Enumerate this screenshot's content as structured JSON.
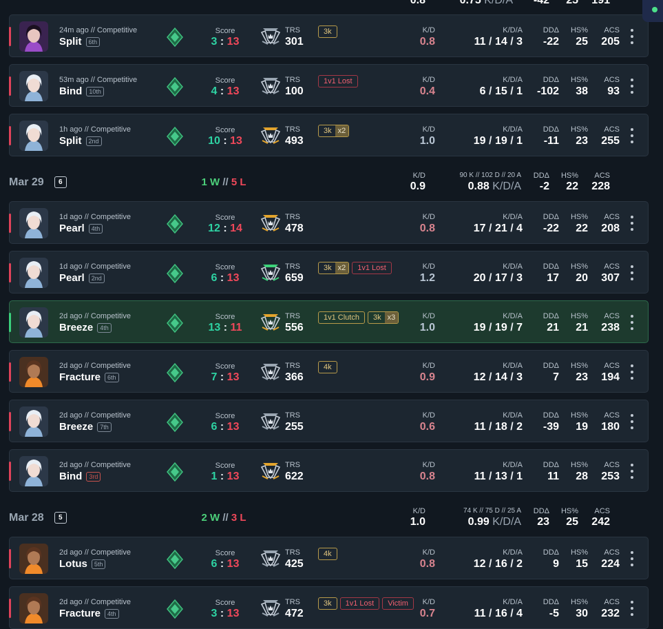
{
  "labels": {
    "score": "Score",
    "trs": "TRS",
    "kd": "K/D",
    "kda": "K/D/A",
    "dd": "DDΔ",
    "hs": "HS%",
    "acs": "ACS",
    "kda_unit": "K/D/A"
  },
  "top_summary": {
    "kd": "0.8",
    "kda": "0.75",
    "dd": "-42",
    "hs": "25",
    "acs": "191"
  },
  "days": [
    {
      "date": "Mar 29",
      "count": "6",
      "wins": "1 W",
      "losses": "5 L",
      "sep": "//",
      "kd": "0.9",
      "kda_sub": "90 K // 102 D // 20 A",
      "kda": "0.88",
      "dd": "-2",
      "hs": "22",
      "acs": "228"
    },
    {
      "date": "Mar 28",
      "count": "5",
      "wins": "2 W",
      "losses": "3 L",
      "sep": "//",
      "kd": "1.0",
      "kda_sub": "74 K // 75 D // 25 A",
      "kda": "0.99",
      "dd": "23",
      "hs": "25",
      "acs": "242"
    }
  ],
  "matches": [
    {
      "agent": "clove",
      "meta": "24m ago // Competitive",
      "map": "Split",
      "place": "6th",
      "place_style": "normal",
      "result": "loss",
      "score_us": "3",
      "score_them": "13",
      "trs": "301",
      "trs_color": "#9aa6b2",
      "badges": [
        {
          "text": "3k",
          "style": "gold"
        }
      ],
      "kd": "0.8",
      "kd_style": "low",
      "k": "11",
      "d": "14",
      "a": "3",
      "dd": "-22",
      "hs": "25",
      "acs": "205"
    },
    {
      "agent": "jett",
      "meta": "53m ago // Competitive",
      "map": "Bind",
      "place": "10th",
      "place_style": "normal",
      "result": "loss",
      "score_us": "4",
      "score_them": "13",
      "trs": "100",
      "trs_color": "#9aa6b2",
      "badges": [
        {
          "text": "1v1 Lost",
          "style": "red"
        }
      ],
      "kd": "0.4",
      "kd_style": "low",
      "k": "6",
      "d": "15",
      "a": "1",
      "dd": "-102",
      "hs": "38",
      "acs": "93"
    },
    {
      "agent": "jett",
      "meta": "1h ago // Competitive",
      "map": "Split",
      "place": "2nd",
      "place_style": "normal",
      "result": "loss",
      "score_us": "10",
      "score_them": "13",
      "trs": "493",
      "trs_color": "#e3a42c",
      "badges": [
        {
          "text": "3k",
          "style": "gold",
          "mult": "x2"
        }
      ],
      "kd": "1.0",
      "kd_style": "high",
      "k": "19",
      "d": "19",
      "a": "1",
      "dd": "-11",
      "hs": "23",
      "acs": "255"
    },
    {
      "agent": "jett",
      "meta": "1d ago // Competitive",
      "map": "Pearl",
      "place": "4th",
      "place_style": "normal",
      "result": "loss",
      "score_us": "12",
      "score_them": "14",
      "trs": "478",
      "trs_color": "#e3a42c",
      "badges": [],
      "kd": "0.8",
      "kd_style": "low",
      "k": "17",
      "d": "21",
      "a": "4",
      "dd": "-22",
      "hs": "22",
      "acs": "208"
    },
    {
      "agent": "jett",
      "meta": "1d ago // Competitive",
      "map": "Pearl",
      "place": "2nd",
      "place_style": "normal",
      "result": "loss",
      "score_us": "6",
      "score_them": "13",
      "trs": "659",
      "trs_color": "#3cd27a",
      "badges": [
        {
          "text": "3k",
          "style": "gold",
          "mult": "x2"
        },
        {
          "text": "1v1 Lost",
          "style": "red"
        }
      ],
      "kd": "1.2",
      "kd_style": "high",
      "k": "20",
      "d": "17",
      "a": "3",
      "dd": "17",
      "hs": "20",
      "acs": "307"
    },
    {
      "agent": "jett",
      "meta": "2d ago // Competitive",
      "map": "Breeze",
      "place": "4th",
      "place_style": "normal",
      "result": "win",
      "score_us": "13",
      "score_them": "11",
      "trs": "556",
      "trs_color": "#e3a42c",
      "badges": [
        {
          "text": "1v1 Clutch",
          "style": "gold"
        },
        {
          "text": "3k",
          "style": "gold",
          "mult": "x3"
        }
      ],
      "kd": "1.0",
      "kd_style": "high",
      "k": "19",
      "d": "19",
      "a": "7",
      "dd": "21",
      "hs": "21",
      "acs": "238"
    },
    {
      "agent": "raze",
      "meta": "2d ago // Competitive",
      "map": "Fracture",
      "place": "6th",
      "place_style": "normal",
      "result": "loss",
      "score_us": "7",
      "score_them": "13",
      "trs": "366",
      "trs_color": "#9aa6b2",
      "badges": [
        {
          "text": "4k",
          "style": "gold"
        }
      ],
      "kd": "0.9",
      "kd_style": "low",
      "k": "12",
      "d": "14",
      "a": "3",
      "dd": "7",
      "hs": "23",
      "acs": "194"
    },
    {
      "agent": "jett",
      "meta": "2d ago // Competitive",
      "map": "Breeze",
      "place": "7th",
      "place_style": "normal",
      "result": "loss",
      "score_us": "6",
      "score_them": "13",
      "trs": "255",
      "trs_color": "#9aa6b2",
      "badges": [],
      "kd": "0.6",
      "kd_style": "low",
      "k": "11",
      "d": "18",
      "a": "2",
      "dd": "-39",
      "hs": "19",
      "acs": "180"
    },
    {
      "agent": "jett",
      "meta": "2d ago // Competitive",
      "map": "Bind",
      "place": "3rd",
      "place_style": "red",
      "result": "loss",
      "score_us": "1",
      "score_them": "13",
      "trs": "622",
      "trs_color": "#e3a42c",
      "badges": [],
      "kd": "0.8",
      "kd_style": "low",
      "k": "11",
      "d": "13",
      "a": "1",
      "dd": "11",
      "hs": "28",
      "acs": "253"
    },
    {
      "agent": "raze",
      "meta": "2d ago // Competitive",
      "map": "Lotus",
      "place": "5th",
      "place_style": "normal",
      "result": "loss",
      "score_us": "6",
      "score_them": "13",
      "trs": "425",
      "trs_color": "#9aa6b2",
      "badges": [
        {
          "text": "4k",
          "style": "gold"
        }
      ],
      "kd": "0.8",
      "kd_style": "low",
      "k": "12",
      "d": "16",
      "a": "2",
      "dd": "9",
      "hs": "15",
      "acs": "224"
    },
    {
      "agent": "raze",
      "meta": "2d ago // Competitive",
      "map": "Fracture",
      "place": "4th",
      "place_style": "normal",
      "result": "loss",
      "score_us": "3",
      "score_them": "13",
      "trs": "472",
      "trs_color": "#9aa6b2",
      "badges": [
        {
          "text": "3k",
          "style": "gold"
        },
        {
          "text": "1v1 Lost",
          "style": "red"
        },
        {
          "text": "Victim",
          "style": "red"
        }
      ],
      "kd": "0.7",
      "kd_style": "low",
      "k": "11",
      "d": "16",
      "a": "4",
      "dd": "-5",
      "hs": "30",
      "acs": "232"
    }
  ],
  "layout_order": [
    "m0",
    "m1",
    "m2",
    "d0",
    "m3",
    "m4",
    "m5",
    "m6",
    "m7",
    "m8",
    "d1",
    "m9",
    "m10"
  ],
  "colors": {
    "win": "#2ed3a3",
    "loss": "#f0485a",
    "win_bar": "#3ad07c",
    "loss_bar": "#e0435a",
    "rank_icon": "#2fa56b"
  }
}
